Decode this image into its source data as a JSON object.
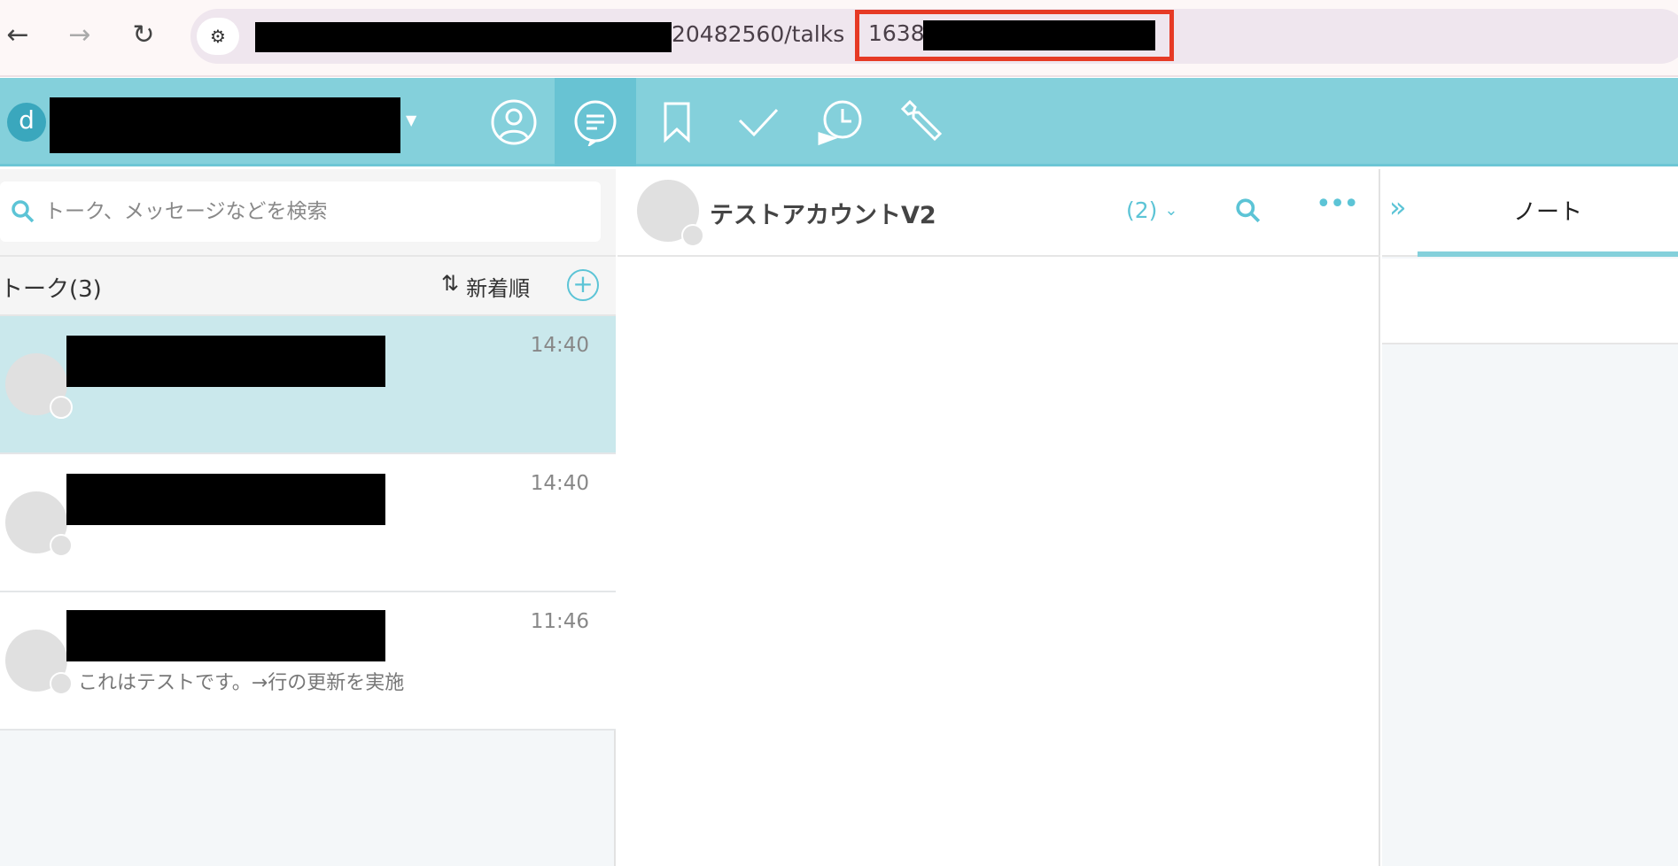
{
  "browser": {
    "url_visible": "20482560/talks",
    "url_highlight": "1638"
  },
  "search": {
    "placeholder": "トーク、メッセージなどを検索"
  },
  "talk_list": {
    "title": "トーク(3)",
    "sort_label": "新着順",
    "items": [
      {
        "time": "14:40",
        "preview": ""
      },
      {
        "time": "14:40",
        "preview": ""
      },
      {
        "time": "11:46",
        "preview": "これはテストです。→行の更新を実施"
      }
    ]
  },
  "chat": {
    "title": "テストアカウントV2",
    "member_count": "(2)"
  },
  "side": {
    "tab": "ノート"
  },
  "colors": {
    "accent": "#84d0db",
    "active": "#68c3d3",
    "highlight": "#e63a25"
  }
}
